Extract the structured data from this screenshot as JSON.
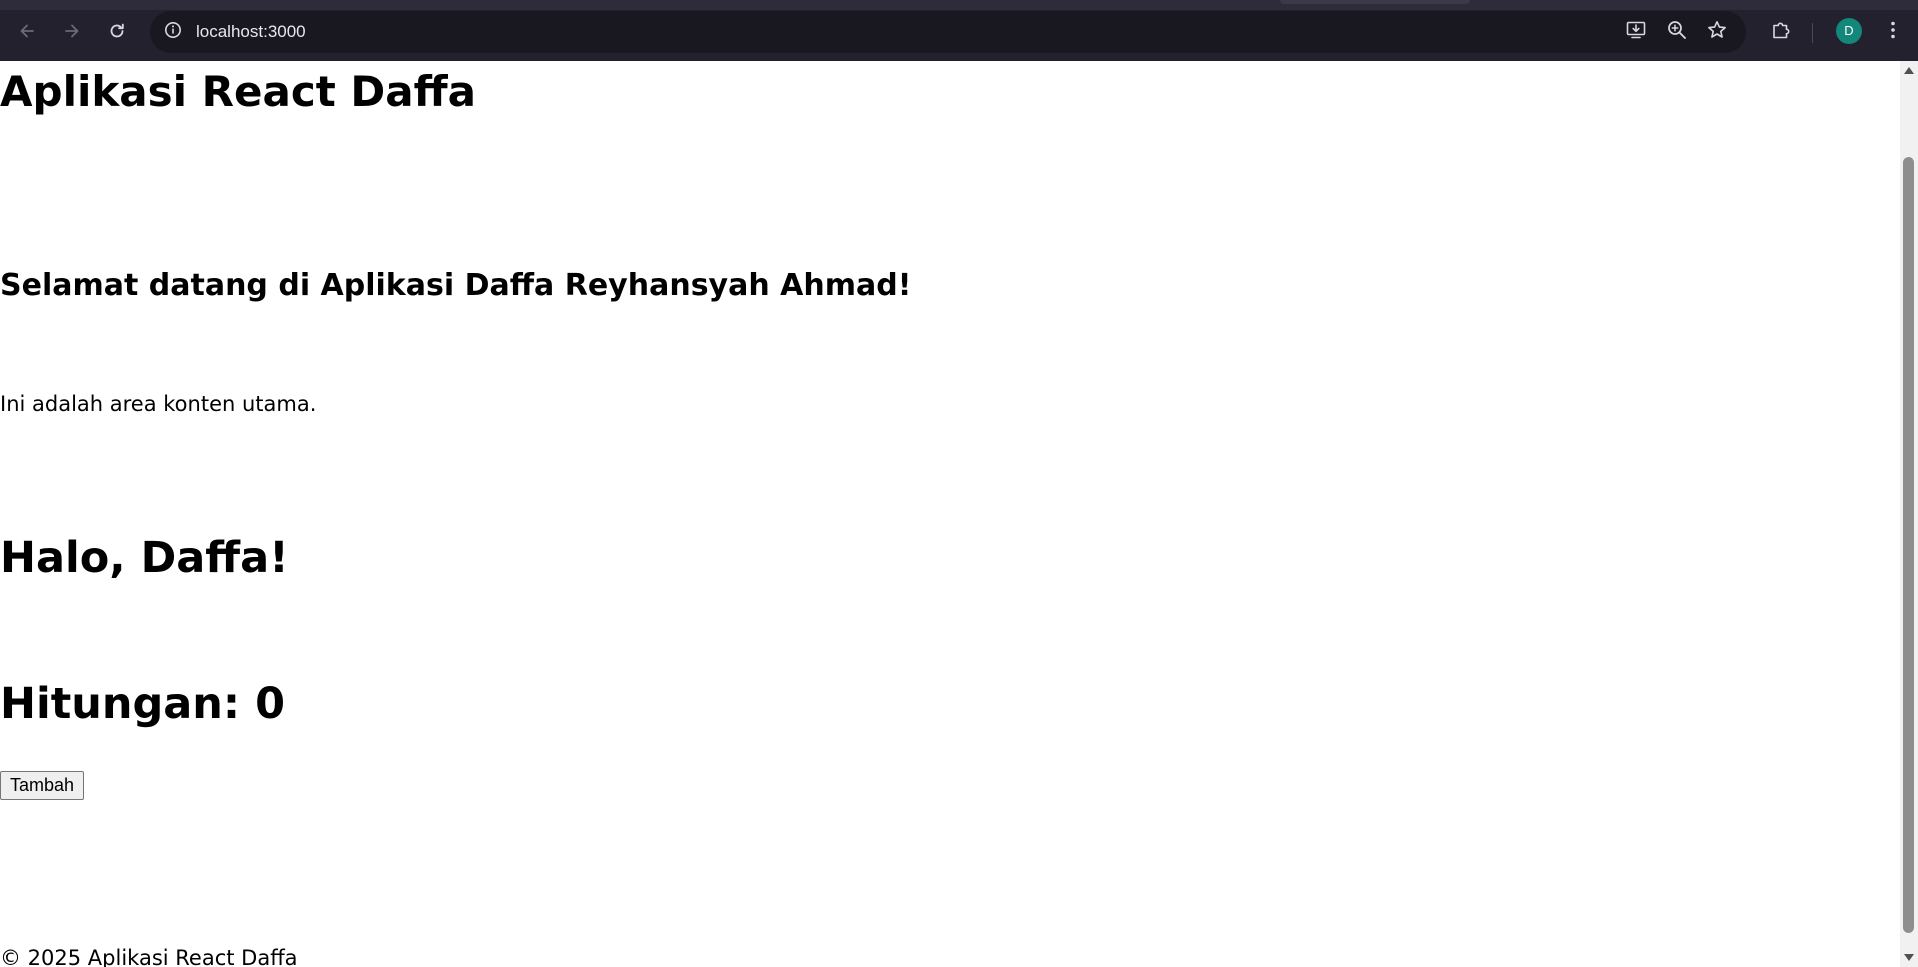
{
  "browser": {
    "url": "localhost:3000",
    "profile_initial": "D",
    "icons": {
      "back": "arrow-left-icon",
      "forward": "arrow-right-icon",
      "reload": "reload-icon",
      "site_info": "info-icon",
      "install": "install-app-icon",
      "zoom": "zoom-icon",
      "bookmark": "star-icon",
      "extensions": "puzzle-icon",
      "menu": "kebab-menu-icon"
    },
    "colors": {
      "chrome_bg": "#23212e",
      "omnibox_bg": "#191720",
      "avatar_bg": "#12877a"
    }
  },
  "page": {
    "title": "Aplikasi React Daffa",
    "welcome": "Selamat datang di Aplikasi Daffa Reyhansyah Ahmad!",
    "content_text": "Ini adalah area konten utama.",
    "greeting": "Halo, Daffa!",
    "counter_label": "Hitungan: 0",
    "add_button_label": "Tambah",
    "footer": "© 2025 Aplikasi React Daffa"
  }
}
